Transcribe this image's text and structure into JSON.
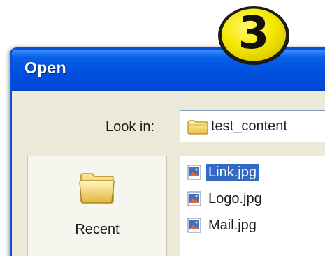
{
  "badge": {
    "number": "3",
    "color": "#f4e600"
  },
  "dialog": {
    "title": "Open",
    "title_bar_color": "#0050e0",
    "look_in": {
      "label": "Look in:",
      "value": "test_content",
      "icon": "folder-icon"
    },
    "places": [
      {
        "label": "Recent",
        "icon": "recent-folder-icon"
      }
    ],
    "files": [
      {
        "name": "Link.jpg",
        "icon": "jpg-file-icon",
        "selected": true
      },
      {
        "name": "Logo.jpg",
        "icon": "jpg-file-icon",
        "selected": false
      },
      {
        "name": "Mail.jpg",
        "icon": "jpg-file-icon",
        "selected": false
      }
    ],
    "selection_color": "#316ac5"
  }
}
